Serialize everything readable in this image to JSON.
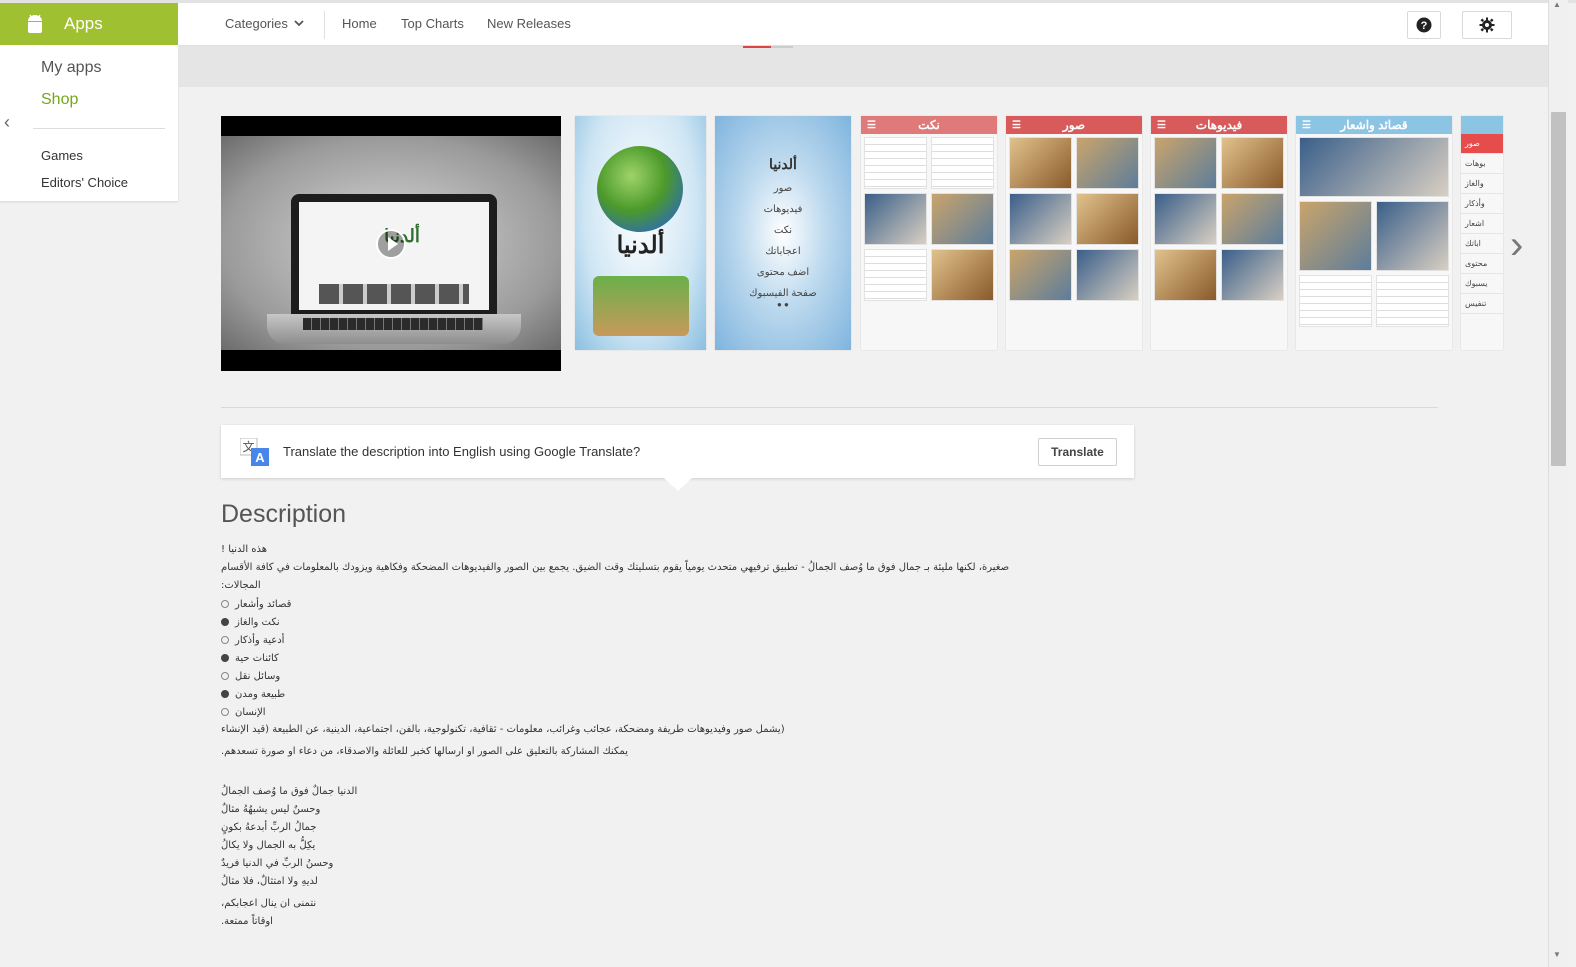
{
  "nav": {
    "apps_title": "Apps",
    "my_apps": "My apps",
    "shop": "Shop",
    "games": "Games",
    "editors_choice": "Editors' Choice",
    "collapse_glyph": "‹"
  },
  "topbar": {
    "categories": "Categories",
    "home": "Home",
    "top_charts": "Top Charts",
    "new_releases": "New Releases"
  },
  "screenshots": {
    "app_name": "ألدنيا",
    "video_logo": "ألدنيا",
    "menu_title": "ألدنيا",
    "menu_items": [
      "صور",
      "فيديوهات",
      "نكت",
      "اعجاباتك",
      "اضف محتوى",
      "صفحة الفيسبوك"
    ],
    "list_headers": [
      "نكت",
      "صور",
      "فيديوهات",
      "قصائد واشعار"
    ],
    "side_menu": [
      "صور",
      "بوهات",
      "والغاز",
      "وأذكار",
      "اشعار",
      "اباتك",
      "محتوى",
      "يسبوك",
      "تنفيس"
    ],
    "next_glyph": "›"
  },
  "translate": {
    "text": "Translate the description into English using Google Translate?",
    "button": "Translate"
  },
  "description": {
    "title": "Description",
    "lines": [
      "هذه الدنيا !",
      "صغيرة، لكنها مليئة بـ جمال فوق ما وُصف الجمالُ - تطبيق ترفيهي متحدث يومياً يقوم بتسليتك وقت الضيق. يجمع بين الصور والفيديوهات المضحكة وفكاهية ويزودك بالمعلومات في كافة الأقسام",
      "المجالات:"
    ],
    "bullets": [
      "قصائد وأشعار",
      "نكت والغاز",
      "أدعية وأذكار",
      "كائنات حية",
      "وسائل نقل",
      "طبيعة ومدن",
      "الإنسان"
    ],
    "after_bullets": [
      "(يشمل صور وفيديوهات طريفة ومضحكة، عجائب وغرائب، معلومات - ثقافية، تكنولوجية، بالفن، اجتماعية، الدينية، عن الطبيعة (قيد الإنشاء",
      "يمكنك المشاركة بالتعليق على الصور او ارسالها كخبر للعائلة والاصدقاء، من دعاء او صورة تسعدهم."
    ],
    "poem": [
      "الدنيا جمالٌ فوق ما وُصف الجمالُ",
      "وحسنٌ ليس يشبهُهُ مثالٌ",
      "جمالُ الربِّ أبدعهُ بكونٍ",
      "يكِلُّ به الجمال ولا يكالُ",
      "وحسنُ الربِّ في الدنيا فريدٌ",
      "لديهِ ولا امتثالٌ، فلا مثالُ"
    ],
    "closing": [
      "نتمنى ان ينال اعجابكم،",
      "اوقاتاً ممتعة."
    ]
  },
  "colors": {
    "accent": "#9fc031",
    "shop_active": "#78a51d",
    "header_jokes": "#e07a7a",
    "header_images": "#d85a5a",
    "header_videos": "#d85a5a",
    "header_poems": "#8cc4e3"
  }
}
